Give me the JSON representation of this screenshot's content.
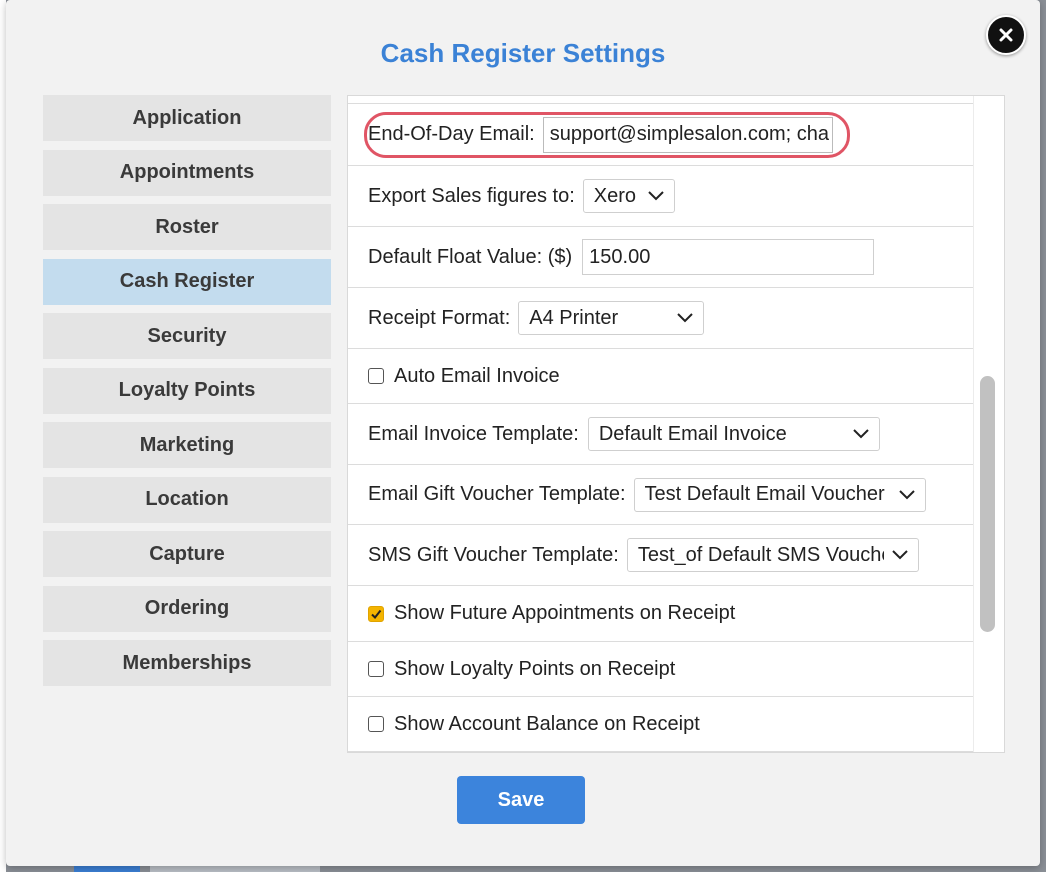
{
  "dialog": {
    "title": "Cash Register Settings",
    "close_icon": "close-icon",
    "save_label": "Save"
  },
  "nav": {
    "active": "Cash Register",
    "items": [
      {
        "label": "Application"
      },
      {
        "label": "Appointments"
      },
      {
        "label": "Roster"
      },
      {
        "label": "Cash Register"
      },
      {
        "label": "Security"
      },
      {
        "label": "Loyalty Points"
      },
      {
        "label": "Marketing"
      },
      {
        "label": "Location"
      },
      {
        "label": "Capture"
      },
      {
        "label": "Ordering"
      },
      {
        "label": "Memberships"
      }
    ]
  },
  "settings": {
    "end_of_day_email": {
      "label": "End-Of-Day Email:",
      "value": "support@simplesalon.com; cha"
    },
    "export_sales": {
      "label": "Export Sales figures to:",
      "value": "Xero"
    },
    "default_float": {
      "label": "Default Float Value: ($)",
      "value": "150.00"
    },
    "receipt_format": {
      "label": "Receipt Format:",
      "value": "A4 Printer"
    },
    "auto_email_invoice": {
      "label": "Auto Email Invoice",
      "checked": false
    },
    "email_invoice_template": {
      "label": "Email Invoice Template:",
      "value": "Default Email Invoice"
    },
    "email_gift_voucher_template": {
      "label": "Email Gift Voucher Template:",
      "value": "Test Default Email Voucher"
    },
    "sms_gift_voucher_template": {
      "label": "SMS Gift Voucher Template:",
      "value": "Test_of Default SMS Vouche"
    },
    "show_future_appointments": {
      "label": "Show Future Appointments on Receipt",
      "checked": true
    },
    "show_loyalty_points": {
      "label": "Show Loyalty Points on Receipt",
      "checked": false
    },
    "show_account_balance": {
      "label": "Show Account Balance on Receipt",
      "checked": false
    }
  },
  "colors": {
    "accent": "#3b82d6",
    "active_nav": "#c3dcee",
    "highlight_ring": "#e05565",
    "checkbox_checked": "#f4b400"
  }
}
